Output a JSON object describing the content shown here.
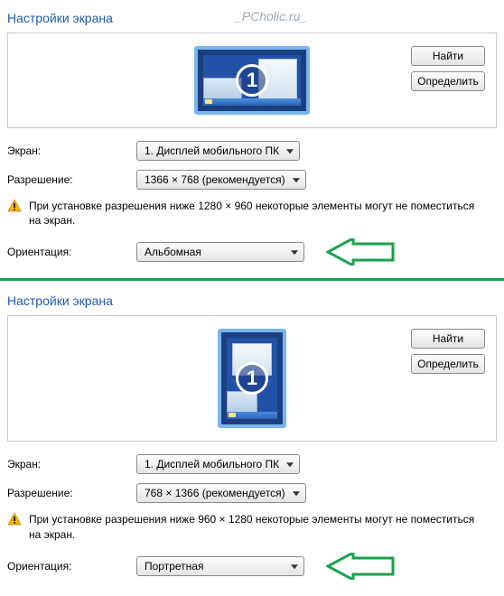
{
  "watermark": "_PCholic.ru_",
  "top": {
    "title": "Настройки экрана",
    "monitor_number": "1",
    "buttons": {
      "find": "Найти",
      "detect": "Определить"
    },
    "screen_label": "Экран:",
    "screen_value": "1. Дисплей мобильного ПК",
    "resolution_label": "Разрешение:",
    "resolution_value": "1366 × 768 (рекомендуется)",
    "warning": "При установке разрешения ниже 1280 × 960 некоторые элементы могут не поместиться на экран.",
    "orientation_label": "Ориентация:",
    "orientation_value": "Альбомная"
  },
  "bottom": {
    "title": "Настройки экрана",
    "monitor_number": "1",
    "buttons": {
      "find": "Найти",
      "detect": "Определить"
    },
    "screen_label": "Экран:",
    "screen_value": "1. Дисплей мобильного ПК",
    "resolution_label": "Разрешение:",
    "resolution_value": "768 × 1366 (рекомендуется)",
    "warning": "При установке разрешения ниже 960 × 1280 некоторые элементы могут не поместиться на экран.",
    "orientation_label": "Ориентация:",
    "orientation_value": "Портретная"
  }
}
